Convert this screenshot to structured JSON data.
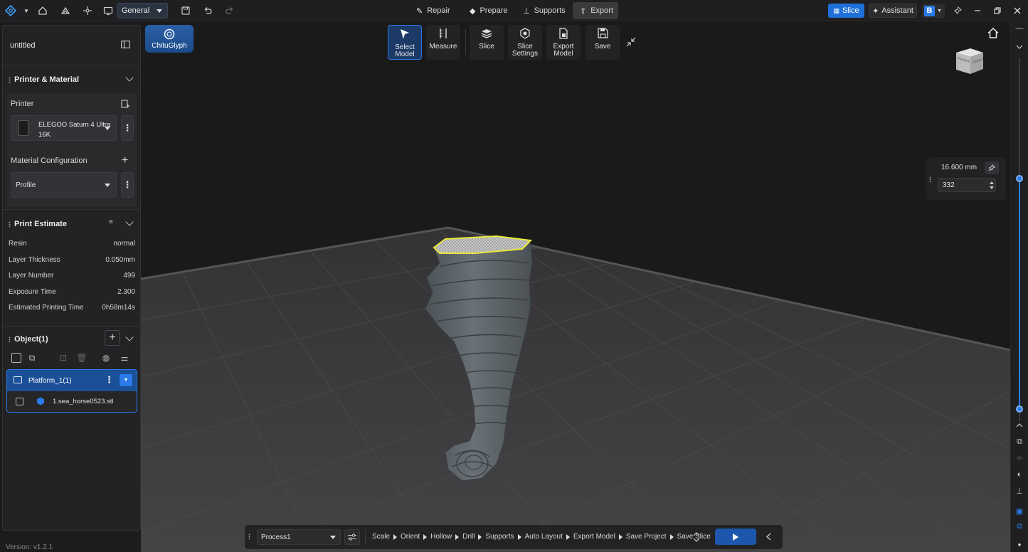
{
  "topbar": {
    "workspace": "General",
    "modes": [
      {
        "label": "Repair",
        "icon": "wrench-icon"
      },
      {
        "label": "Prepare",
        "icon": "cube-icon"
      },
      {
        "label": "Supports",
        "icon": "supports-icon"
      },
      {
        "label": "Export",
        "icon": "export-icon",
        "active": true
      }
    ],
    "slice_label": "Slice",
    "assistant_label": "Assistant"
  },
  "left_panel": {
    "project_name": "untitled",
    "printer_material": {
      "title": "Printer & Material",
      "printer_label": "Printer",
      "printer_name_line1": "ELEGOO Saturn 4 Ultra",
      "printer_name_line2": "16K",
      "material_label": "Material Configuration",
      "profile": "Profile"
    },
    "print_estimate": {
      "title": "Print Estimate",
      "rows": [
        {
          "label": "Resin",
          "value": "normal"
        },
        {
          "label": "Layer Thickness",
          "value": "0.050mm"
        },
        {
          "label": "Layer Number",
          "value": "499"
        },
        {
          "label": "Exposure Time",
          "value": "2.300"
        },
        {
          "label": "Estimated Printing Time",
          "value": "0h58m14s"
        }
      ]
    },
    "objects": {
      "title": "Object(1)",
      "platform": "Platform_1(1)",
      "file": "1.sea_horse0523.stl"
    },
    "version": "Version: v1.2.1"
  },
  "toolbar": {
    "plugin_label": "ChituGlyph",
    "tools": [
      {
        "line1": "Select",
        "line2": "Model",
        "icon": "cursor-icon",
        "active": true
      },
      {
        "line1": "Measure",
        "line2": "",
        "icon": "ruler-icon"
      },
      {
        "line1": "Slice",
        "line2": "",
        "icon": "layers-icon"
      },
      {
        "line1": "Slice",
        "line2": "Settings",
        "icon": "slice-settings-icon"
      },
      {
        "line1": "Export",
        "line2": "Model",
        "icon": "export-model-icon"
      },
      {
        "line1": "Save",
        "line2": "",
        "icon": "save-icon"
      }
    ]
  },
  "layer_slider": {
    "height_mm": "16.600 mm",
    "layer": "332"
  },
  "view_cube": {
    "front": "FRONT",
    "right": "RIGHT"
  },
  "bottom_bar": {
    "process": "Process1",
    "steps": [
      "Scale",
      "Orient",
      "Hollow",
      "Drill",
      "Supports",
      "Auto Layout",
      "Export Model",
      "Save Project",
      "Save Slice"
    ]
  },
  "colors": {
    "accent": "#2a7be8",
    "highlight": "#e8e83a"
  }
}
